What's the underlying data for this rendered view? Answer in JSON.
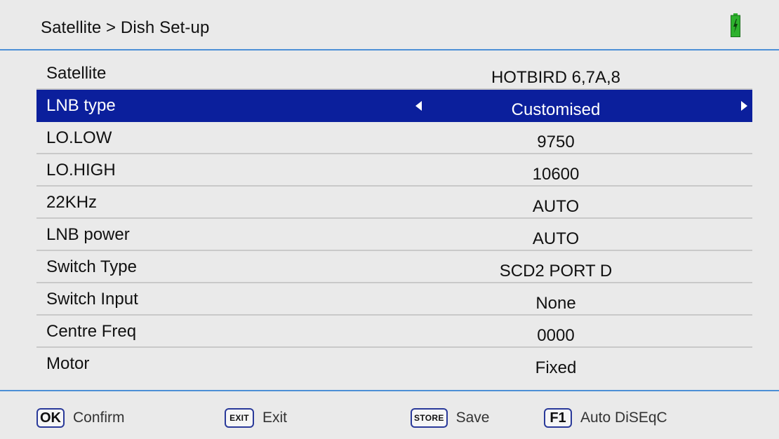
{
  "header": {
    "breadcrumb": "Satellite > Dish Set-up",
    "battery_icon": "battery-charging-icon",
    "battery_color": "#2db12d"
  },
  "settings": [
    {
      "label": "Satellite",
      "value": "HOTBIRD 6,7A,8"
    },
    {
      "label": "LNB type",
      "value": "Customised",
      "selected": true
    },
    {
      "label": "LO.LOW",
      "value": "9750"
    },
    {
      "label": "LO.HIGH",
      "value": "10600"
    },
    {
      "label": "22KHz",
      "value": "AUTO"
    },
    {
      "label": "LNB power",
      "value": "AUTO"
    },
    {
      "label": "Switch Type",
      "value": "SCD2 PORT D"
    },
    {
      "label": "Switch Input",
      "value": "None"
    },
    {
      "label": "Centre Freq",
      "value": "0000"
    },
    {
      "label": "Motor",
      "value": "Fixed"
    }
  ],
  "colors": {
    "selected_row": "#0b1f9c",
    "divider": "#4d8fd6",
    "background": "#eaeaea"
  },
  "footer": {
    "hints": [
      {
        "key": "OK",
        "label": "Confirm",
        "icon": "ok-key-icon"
      },
      {
        "key": "EXIT",
        "label": "Exit",
        "icon": "exit-key-icon"
      },
      {
        "key": "STORE",
        "label": "Save",
        "icon": "store-key-icon"
      },
      {
        "key": "F1",
        "label": "Auto DiSEqC",
        "icon": "f1-key-icon"
      }
    ]
  }
}
